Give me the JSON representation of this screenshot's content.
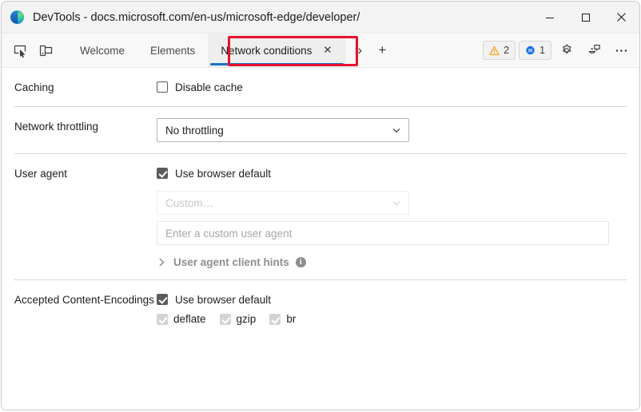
{
  "window": {
    "title": "DevTools - docs.microsoft.com/en-us/microsoft-edge/developer/",
    "minimize_label": "Minimize",
    "maximize_label": "Maximize",
    "close_label": "Close"
  },
  "toolbar": {
    "inspect_label": "Inspect element",
    "device_label": "Toggle device emulation",
    "more_tabs_label": "»",
    "add_tab_label": "+",
    "warnings_count": "2",
    "issues_count": "1",
    "settings_label": "Settings",
    "feedback_label": "Send feedback",
    "more_label": "Customize and control DevTools"
  },
  "tabs": [
    {
      "label": "Welcome",
      "active": false
    },
    {
      "label": "Elements",
      "active": false
    },
    {
      "label": "Network conditions",
      "active": true,
      "close_label": "✕"
    }
  ],
  "panel": {
    "caching": {
      "label": "Caching",
      "disable_cache_label": "Disable cache",
      "disable_cache_checked": false
    },
    "throttling": {
      "label": "Network throttling",
      "value": "No throttling"
    },
    "user_agent": {
      "label": "User agent",
      "use_default_label": "Use browser default",
      "use_default_checked": true,
      "custom_select_value": "Custom…",
      "custom_input_placeholder": "Enter a custom user agent",
      "client_hints_label": "User agent client hints",
      "client_hints_info": "i"
    },
    "encodings": {
      "label": "Accepted Content-Encodings",
      "use_default_label": "Use browser default",
      "use_default_checked": true,
      "options": [
        {
          "label": "deflate",
          "checked": true,
          "disabled": true
        },
        {
          "label": "gzip",
          "checked": true,
          "disabled": true
        },
        {
          "label": "br",
          "checked": true,
          "disabled": true
        }
      ]
    }
  },
  "colors": {
    "accent_blue": "#1a73c8",
    "highlight_red": "#e8112d",
    "warning_amber": "#f5a623",
    "issue_blue": "#1a73e8"
  }
}
